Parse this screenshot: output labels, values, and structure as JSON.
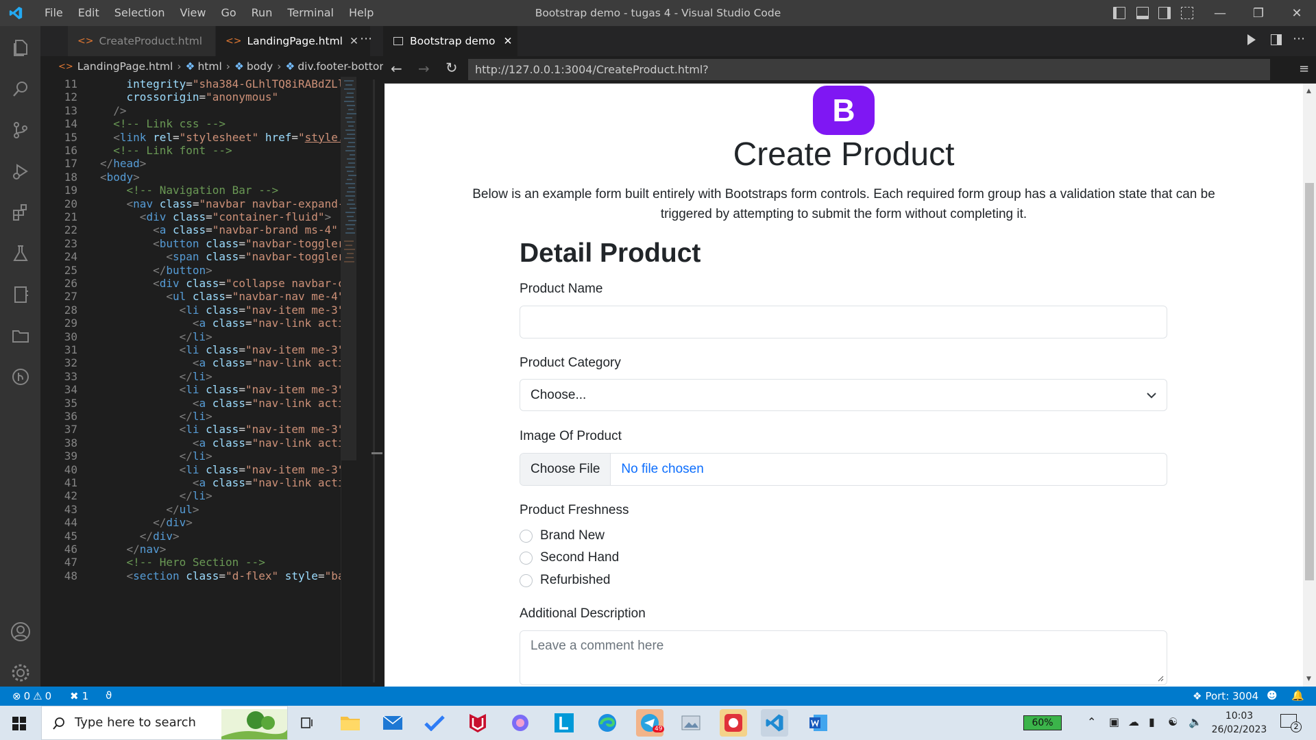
{
  "window": {
    "title": "Bootstrap demo - tugas 4 - Visual Studio Code",
    "menu": [
      "File",
      "Edit",
      "Selection",
      "View",
      "Go",
      "Run",
      "Terminal",
      "Help"
    ]
  },
  "editor": {
    "tabs": [
      {
        "label": "CreateProduct.html",
        "active": false
      },
      {
        "label": "LandingPage.html",
        "active": true
      }
    ],
    "breadcrumb": [
      "LandingPage.html",
      "html",
      "body",
      "div.footer-bottom"
    ],
    "lines": [
      {
        "n": "11",
        "html": "    <span class='at'>integrity</span>=<span class='st'>\"sha384-GLhlTQ8iRABdZLl</span>"
      },
      {
        "n": "12",
        "html": "    <span class='at'>crossorigin</span>=<span class='st'>\"anonymous\"</span>"
      },
      {
        "n": "13",
        "html": "  <span class='pu'>/&gt;</span>"
      },
      {
        "n": "14",
        "html": "  <span class='cm'>&lt;!-- Link css --&gt;</span>"
      },
      {
        "n": "15",
        "html": "  <span class='pu'>&lt;</span><span class='tg'>link</span> <span class='at'>rel</span>=<span class='st'>\"stylesheet\"</span> <span class='at'>href</span>=<span class='st'>\"<u>style.</u></span>"
      },
      {
        "n": "16",
        "html": "  <span class='cm'>&lt;!-- Link font --&gt;</span>"
      },
      {
        "n": "17",
        "html": "<span class='pu'>&lt;/</span><span class='tg'>head</span><span class='pu'>&gt;</span>"
      },
      {
        "n": "18",
        "html": "<span class='pu'>&lt;</span><span class='tg'>body</span><span class='pu'>&gt;</span>"
      },
      {
        "n": "19",
        "html": "    <span class='cm'>&lt;!-- Navigation Bar --&gt;</span>"
      },
      {
        "n": "20",
        "html": "    <span class='pu'>&lt;</span><span class='tg'>nav</span> <span class='at'>class</span>=<span class='st'>\"navbar navbar-expand-</span>"
      },
      {
        "n": "21",
        "html": "      <span class='pu'>&lt;</span><span class='tg'>div</span> <span class='at'>class</span>=<span class='st'>\"container-fluid\"</span><span class='pu'>&gt;</span>"
      },
      {
        "n": "22",
        "html": "        <span class='pu'>&lt;</span><span class='tg'>a</span> <span class='at'>class</span>=<span class='st'>\"navbar-brand ms-4\"</span> <span class='at'>h</span>"
      },
      {
        "n": "23",
        "html": "        <span class='pu'>&lt;</span><span class='tg'>button</span> <span class='at'>class</span>=<span class='st'>\"navbar-toggler</span>"
      },
      {
        "n": "24",
        "html": "          <span class='pu'>&lt;</span><span class='tg'>span</span> <span class='at'>class</span>=<span class='st'>\"navbar-toggler</span>"
      },
      {
        "n": "25",
        "html": "        <span class='pu'>&lt;/</span><span class='tg'>button</span><span class='pu'>&gt;</span>"
      },
      {
        "n": "26",
        "html": "        <span class='pu'>&lt;</span><span class='tg'>div</span> <span class='at'>class</span>=<span class='st'>\"collapse navbar-co</span>"
      },
      {
        "n": "27",
        "html": "          <span class='pu'>&lt;</span><span class='tg'>ul</span> <span class='at'>class</span>=<span class='st'>\"navbar-nav me-4\"</span>"
      },
      {
        "n": "28",
        "html": "            <span class='pu'>&lt;</span><span class='tg'>li</span> <span class='at'>class</span>=<span class='st'>\"nav-item me-3\"</span>"
      },
      {
        "n": "29",
        "html": "              <span class='pu'>&lt;</span><span class='tg'>a</span> <span class='at'>class</span>=<span class='st'>\"nav-link acti</span>"
      },
      {
        "n": "30",
        "html": "            <span class='pu'>&lt;/</span><span class='tg'>li</span><span class='pu'>&gt;</span>"
      },
      {
        "n": "31",
        "html": "            <span class='pu'>&lt;</span><span class='tg'>li</span> <span class='at'>class</span>=<span class='st'>\"nav-item me-3\"</span>"
      },
      {
        "n": "32",
        "html": "              <span class='pu'>&lt;</span><span class='tg'>a</span> <span class='at'>class</span>=<span class='st'>\"nav-link acti</span>"
      },
      {
        "n": "33",
        "html": "            <span class='pu'>&lt;/</span><span class='tg'>li</span><span class='pu'>&gt;</span>"
      },
      {
        "n": "34",
        "html": "            <span class='pu'>&lt;</span><span class='tg'>li</span> <span class='at'>class</span>=<span class='st'>\"nav-item me-3\"</span>"
      },
      {
        "n": "35",
        "html": "              <span class='pu'>&lt;</span><span class='tg'>a</span> <span class='at'>class</span>=<span class='st'>\"nav-link acti</span>"
      },
      {
        "n": "36",
        "html": "            <span class='pu'>&lt;/</span><span class='tg'>li</span><span class='pu'>&gt;</span>"
      },
      {
        "n": "37",
        "html": "            <span class='pu'>&lt;</span><span class='tg'>li</span> <span class='at'>class</span>=<span class='st'>\"nav-item me-3\"</span>"
      },
      {
        "n": "38",
        "html": "              <span class='pu'>&lt;</span><span class='tg'>a</span> <span class='at'>class</span>=<span class='st'>\"nav-link acti</span>"
      },
      {
        "n": "39",
        "html": "            <span class='pu'>&lt;/</span><span class='tg'>li</span><span class='pu'>&gt;</span>"
      },
      {
        "n": "40",
        "html": "            <span class='pu'>&lt;</span><span class='tg'>li</span> <span class='at'>class</span>=<span class='st'>\"nav-item me-3\"</span>"
      },
      {
        "n": "41",
        "html": "              <span class='pu'>&lt;</span><span class='tg'>a</span> <span class='at'>class</span>=<span class='st'>\"nav-link acti</span>"
      },
      {
        "n": "42",
        "html": "            <span class='pu'>&lt;/</span><span class='tg'>li</span><span class='pu'>&gt;</span>"
      },
      {
        "n": "43",
        "html": "          <span class='pu'>&lt;/</span><span class='tg'>ul</span><span class='pu'>&gt;</span>"
      },
      {
        "n": "44",
        "html": "        <span class='pu'>&lt;/</span><span class='tg'>div</span><span class='pu'>&gt;</span>"
      },
      {
        "n": "45",
        "html": "      <span class='pu'>&lt;/</span><span class='tg'>div</span><span class='pu'>&gt;</span>"
      },
      {
        "n": "46",
        "html": "    <span class='pu'>&lt;/</span><span class='tg'>nav</span><span class='pu'>&gt;</span>"
      },
      {
        "n": "47",
        "html": "    <span class='cm'>&lt;!-- Hero Section --&gt;</span>"
      },
      {
        "n": "48",
        "html": "    <span class='pu'>&lt;</span><span class='tg'>section</span> <span class='at'>class</span>=<span class='st'>\"d-flex\"</span> <span class='at'>style</span>=<span class='st'>\"ba</span>"
      }
    ]
  },
  "preview": {
    "tab_label": "Bootstrap demo",
    "url": "http://127.0.0.1:3004/CreateProduct.html?",
    "logo_letter": "B",
    "heading": "Create Product",
    "lead_line1": "Below is an example form built entirely with Bootstraps form controls. Each required form group has a validation state that can be",
    "lead_line2": "triggered by attempting to submit the form without completing it.",
    "form": {
      "title": "Detail Product",
      "name_label": "Product Name",
      "category_label": "Product Category",
      "category_selected": "Choose...",
      "image_label": "Image Of Product",
      "file_button": "Choose File",
      "file_status": "No file chosen",
      "freshness_label": "Product Freshness",
      "freshness_options": [
        "Brand New",
        "Second Hand",
        "Refurbished"
      ],
      "description_label": "Additional Description",
      "description_placeholder": "Leave a comment here"
    }
  },
  "statusbar": {
    "errors": "0",
    "warnings": "0",
    "ports_count": "1",
    "port": "Port: 3004"
  },
  "taskbar": {
    "search_placeholder": "Type here to search",
    "battery": "60%",
    "time": "10:03",
    "date": "26/02/2023",
    "notifications": "2",
    "telegram_badge": "49"
  },
  "colors": {
    "vscode_blue": "#007acc",
    "bootstrap_purple": "#7f17f3",
    "link_blue": "#0d6efd"
  }
}
